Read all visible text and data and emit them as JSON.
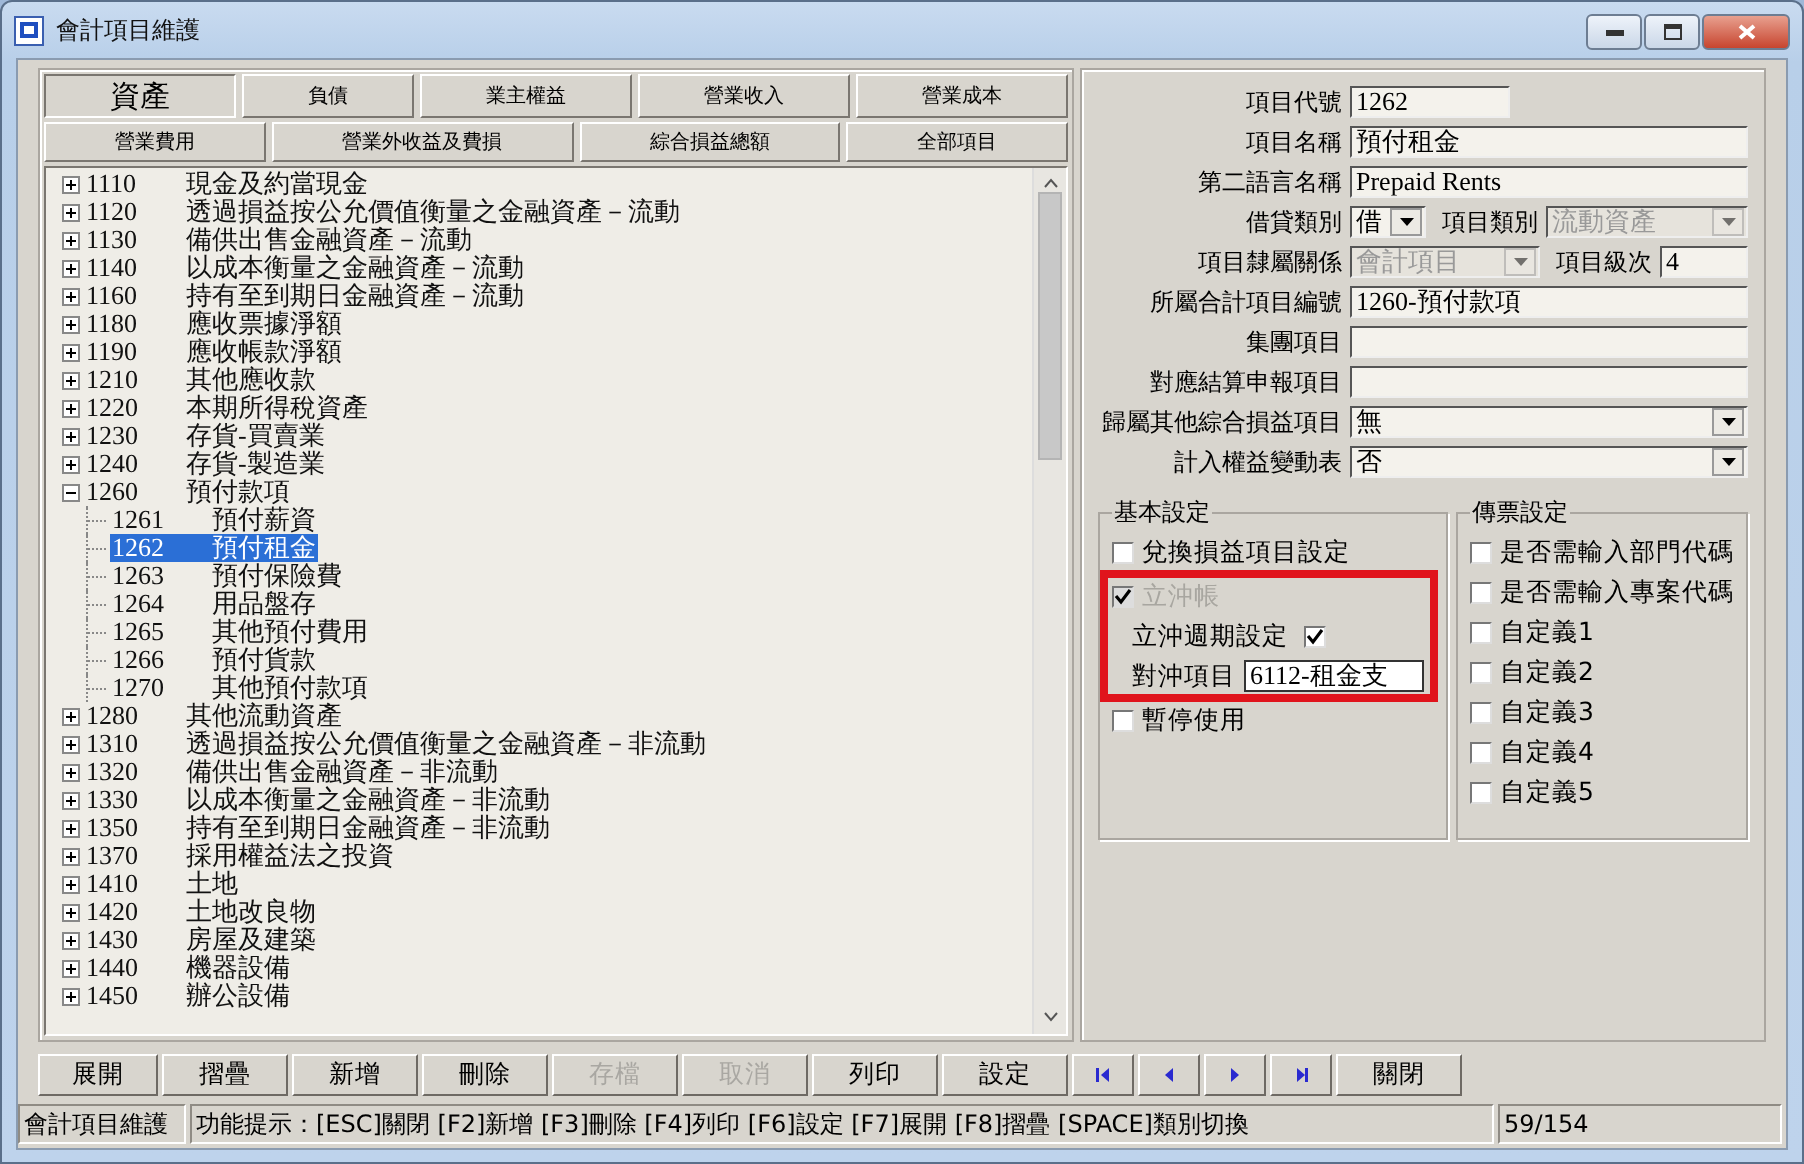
{
  "window": {
    "title": "會計項目維護"
  },
  "tab_rows": [
    [
      {
        "label": "資產",
        "selected": true
      },
      {
        "label": "負債",
        "selected": false
      },
      {
        "label": "業主權益",
        "selected": false
      },
      {
        "label": "營業收入",
        "selected": false
      },
      {
        "label": "營業成本",
        "selected": false
      }
    ],
    [
      {
        "label": "營業費用",
        "selected": false
      },
      {
        "label": "營業外收益及費損",
        "selected": false
      },
      {
        "label": "綜合損益總額",
        "selected": false
      },
      {
        "label": "全部項目",
        "selected": false
      }
    ]
  ],
  "tree": [
    {
      "code": "1110",
      "name": "現金及約當現金",
      "expanded": false,
      "selected": false
    },
    {
      "code": "1120",
      "name": "透過損益按公允價值衡量之金融資產－流動",
      "expanded": false,
      "selected": false
    },
    {
      "code": "1130",
      "name": "備供出售金融資產－流動",
      "expanded": false,
      "selected": false
    },
    {
      "code": "1140",
      "name": "以成本衡量之金融資產－流動",
      "expanded": false,
      "selected": false
    },
    {
      "code": "1160",
      "name": "持有至到期日金融資產－流動",
      "expanded": false,
      "selected": false
    },
    {
      "code": "1180",
      "name": "應收票據淨額",
      "expanded": false,
      "selected": false
    },
    {
      "code": "1190",
      "name": "應收帳款淨額",
      "expanded": false,
      "selected": false
    },
    {
      "code": "1210",
      "name": "其他應收款",
      "expanded": false,
      "selected": false
    },
    {
      "code": "1220",
      "name": "本期所得稅資產",
      "expanded": false,
      "selected": false
    },
    {
      "code": "1230",
      "name": "存貨-買賣業",
      "expanded": false,
      "selected": false
    },
    {
      "code": "1240",
      "name": "存貨-製造業",
      "expanded": false,
      "selected": false
    },
    {
      "code": "1260",
      "name": "預付款項",
      "expanded": true,
      "selected": false,
      "children": [
        {
          "code": "1261",
          "name": "預付薪資",
          "selected": false
        },
        {
          "code": "1262",
          "name": "預付租金",
          "selected": true
        },
        {
          "code": "1263",
          "name": "預付保險費",
          "selected": false
        },
        {
          "code": "1264",
          "name": "用品盤存",
          "selected": false
        },
        {
          "code": "1265",
          "name": "其他預付費用",
          "selected": false
        },
        {
          "code": "1266",
          "name": "預付貨款",
          "selected": false
        },
        {
          "code": "1270",
          "name": "其他預付款項",
          "selected": false
        }
      ]
    },
    {
      "code": "1280",
      "name": "其他流動資產",
      "expanded": false,
      "selected": false
    },
    {
      "code": "1310",
      "name": "透過損益按公允價值衡量之金融資產－非流動",
      "expanded": false,
      "selected": false
    },
    {
      "code": "1320",
      "name": "備供出售金融資產－非流動",
      "expanded": false,
      "selected": false
    },
    {
      "code": "1330",
      "name": "以成本衡量之金融資產－非流動",
      "expanded": false,
      "selected": false
    },
    {
      "code": "1350",
      "name": "持有至到期日金融資產－非流動",
      "expanded": false,
      "selected": false
    },
    {
      "code": "1370",
      "name": "採用權益法之投資",
      "expanded": false,
      "selected": false
    },
    {
      "code": "1410",
      "name": "土地",
      "expanded": false,
      "selected": false
    },
    {
      "code": "1420",
      "name": "土地改良物",
      "expanded": false,
      "selected": false
    },
    {
      "code": "1430",
      "name": "房屋及建築",
      "expanded": false,
      "selected": false
    },
    {
      "code": "1440",
      "name": "機器設備",
      "expanded": false,
      "selected": false
    },
    {
      "code": "1450",
      "name": "辦公設備",
      "expanded": false,
      "selected": false
    }
  ],
  "form_rows": [
    [
      {
        "label": "項目代號",
        "kind": "short_text",
        "value": "1262",
        "disabled": false
      }
    ],
    [
      {
        "label": "項目名稱",
        "kind": "text",
        "value": "預付租金",
        "disabled": false
      }
    ],
    [
      {
        "label": "第二語言名稱",
        "kind": "text",
        "value": "Prepaid Rents",
        "disabled": false
      }
    ],
    [
      {
        "label": "借貸類別",
        "kind": "small_select",
        "value": "借",
        "disabled": false
      },
      {
        "label": "項目類別",
        "kind": "select",
        "value": "流動資產",
        "disabled": true
      }
    ],
    [
      {
        "label": "項目隸屬關係",
        "kind": "select",
        "value": "會計項目",
        "disabled": true
      },
      {
        "label": "項目級次",
        "kind": "short_text",
        "value": "4",
        "disabled": false
      }
    ],
    [
      {
        "label": "所屬合計項目編號",
        "kind": "text",
        "value": "1260-預付款項",
        "disabled": false
      }
    ],
    [
      {
        "label": "集團項目",
        "kind": "text",
        "disabled": false
      }
    ],
    [
      {
        "label": "對應結算申報項目",
        "kind": "text",
        "disabled": false
      }
    ],
    [
      {
        "label": "歸屬其他綜合損益項目",
        "kind": "select",
        "value": "無",
        "disabled": false
      }
    ],
    [
      {
        "label": "計入權益變動表",
        "kind": "select",
        "value": "否",
        "disabled": false
      }
    ]
  ],
  "groups": [
    {
      "title": "基本設定",
      "items": [
        {
          "kind": "checkbox",
          "label": "兌換損益項目設定",
          "checked": false,
          "disabled": false,
          "highlighted": false
        },
        {
          "kind": "checkbox",
          "label": "立沖帳",
          "checked": true,
          "disabled": true,
          "highlighted": true
        },
        {
          "kind": "checkbox_right",
          "label": "立沖週期設定",
          "checked": true,
          "disabled": false,
          "highlighted": true
        },
        {
          "kind": "field",
          "label": "對沖項目",
          "value": "6112-租金支",
          "highlighted": true
        },
        {
          "kind": "checkbox",
          "label": "暫停使用",
          "checked": false,
          "disabled": false,
          "highlighted": false
        }
      ]
    },
    {
      "title": "傳票設定",
      "items": [
        {
          "kind": "checkbox",
          "label": "是否需輸入部門代碼",
          "checked": false,
          "disabled": false,
          "highlighted": false
        },
        {
          "kind": "checkbox",
          "label": "是否需輸入專案代碼",
          "checked": false,
          "disabled": false,
          "highlighted": false
        },
        {
          "kind": "checkbox",
          "label": "自定義1",
          "checked": false,
          "disabled": false,
          "highlighted": false
        },
        {
          "kind": "checkbox",
          "label": "自定義2",
          "checked": false,
          "disabled": false,
          "highlighted": false
        },
        {
          "kind": "checkbox",
          "label": "自定義3",
          "checked": false,
          "disabled": false,
          "highlighted": false
        },
        {
          "kind": "checkbox",
          "label": "自定義4",
          "checked": false,
          "disabled": false,
          "highlighted": false
        },
        {
          "kind": "checkbox",
          "label": "自定義5",
          "checked": false,
          "disabled": false,
          "highlighted": false
        }
      ]
    }
  ],
  "buttons": [
    {
      "kind": "text",
      "label": "展開",
      "disabled": false
    },
    {
      "kind": "text",
      "label": "摺疊",
      "disabled": false
    },
    {
      "kind": "text",
      "label": "新增",
      "disabled": false
    },
    {
      "kind": "text",
      "label": "刪除",
      "disabled": false
    },
    {
      "kind": "text",
      "label": "存檔",
      "disabled": true
    },
    {
      "kind": "text",
      "label": "取消",
      "disabled": true
    },
    {
      "kind": "text",
      "label": "列印",
      "disabled": false
    },
    {
      "kind": "text",
      "label": "設定",
      "disabled": false
    },
    {
      "kind": "first",
      "disabled": false
    },
    {
      "kind": "prev",
      "disabled": false
    },
    {
      "kind": "next",
      "disabled": false
    },
    {
      "kind": "last",
      "disabled": false
    },
    {
      "kind": "text",
      "label": "關閉",
      "disabled": false
    }
  ],
  "status_bar": {
    "module": "會計項目維護",
    "hint": "功能提示：[ESC]關閉 [F2]新增 [F3]刪除 [F4]列印 [F6]設定 [F7]展開 [F8]摺疊 [SPACE]類別切換",
    "position": "59/154"
  }
}
